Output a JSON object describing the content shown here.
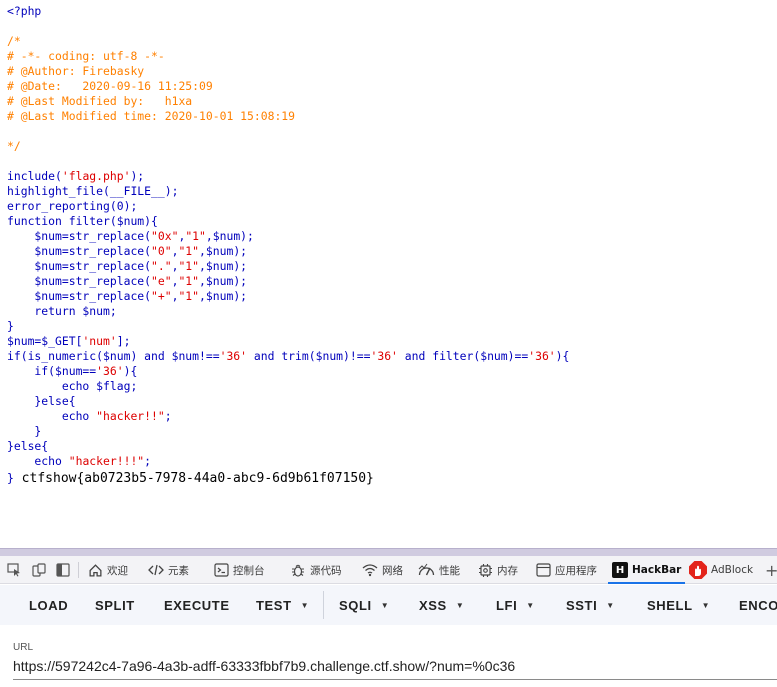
{
  "source_view": {
    "lines": [
      [
        {
          "t": "<?php",
          "c": "default"
        }
      ],
      [],
      [
        {
          "t": "/*",
          "c": "comment"
        }
      ],
      [
        {
          "t": "# -*- coding: utf-8 -*-",
          "c": "comment"
        }
      ],
      [
        {
          "t": "# @Author: Firebasky",
          "c": "comment"
        }
      ],
      [
        {
          "t": "# @Date:   2020-09-16 11:25:09",
          "c": "comment"
        }
      ],
      [
        {
          "t": "# @Last Modified by:   h1xa",
          "c": "comment"
        }
      ],
      [
        {
          "t": "# @Last Modified time: 2020-10-01 15:08:19",
          "c": "comment"
        }
      ],
      [],
      [
        {
          "t": "*/",
          "c": "comment"
        }
      ],
      [],
      [
        {
          "t": "include(",
          "c": "default"
        },
        {
          "t": "'flag.php'",
          "c": "string"
        },
        {
          "t": ");",
          "c": "default"
        }
      ],
      [
        {
          "t": "highlight_file(__FILE__);",
          "c": "default"
        }
      ],
      [
        {
          "t": "error_reporting(0);",
          "c": "default"
        }
      ],
      [
        {
          "t": "function filter($num){",
          "c": "default"
        }
      ],
      [
        {
          "t": "    $num=str_replace(",
          "c": "default"
        },
        {
          "t": "\"0x\"",
          "c": "string"
        },
        {
          "t": ",",
          "c": "default"
        },
        {
          "t": "\"1\"",
          "c": "string"
        },
        {
          "t": ",$num);",
          "c": "default"
        }
      ],
      [
        {
          "t": "    $num=str_replace(",
          "c": "default"
        },
        {
          "t": "\"0\"",
          "c": "string"
        },
        {
          "t": ",",
          "c": "default"
        },
        {
          "t": "\"1\"",
          "c": "string"
        },
        {
          "t": ",$num);",
          "c": "default"
        }
      ],
      [
        {
          "t": "    $num=str_replace(",
          "c": "default"
        },
        {
          "t": "\".\"",
          "c": "string"
        },
        {
          "t": ",",
          "c": "default"
        },
        {
          "t": "\"1\"",
          "c": "string"
        },
        {
          "t": ",$num);",
          "c": "default"
        }
      ],
      [
        {
          "t": "    $num=str_replace(",
          "c": "default"
        },
        {
          "t": "\"e\"",
          "c": "string"
        },
        {
          "t": ",",
          "c": "default"
        },
        {
          "t": "\"1\"",
          "c": "string"
        },
        {
          "t": ",$num);",
          "c": "default"
        }
      ],
      [
        {
          "t": "    $num=str_replace(",
          "c": "default"
        },
        {
          "t": "\"+\"",
          "c": "string"
        },
        {
          "t": ",",
          "c": "default"
        },
        {
          "t": "\"1\"",
          "c": "string"
        },
        {
          "t": ",$num);",
          "c": "default"
        }
      ],
      [
        {
          "t": "    return $num;",
          "c": "default"
        }
      ],
      [
        {
          "t": "}",
          "c": "default"
        }
      ],
      [
        {
          "t": "$num=$_GET[",
          "c": "default"
        },
        {
          "t": "'num'",
          "c": "string"
        },
        {
          "t": "];",
          "c": "default"
        }
      ],
      [
        {
          "t": "if(is_numeric($num) and $num!==",
          "c": "default"
        },
        {
          "t": "'36'",
          "c": "string"
        },
        {
          "t": " and trim($num)!==",
          "c": "default"
        },
        {
          "t": "'36'",
          "c": "string"
        },
        {
          "t": " and filter($num)==",
          "c": "default"
        },
        {
          "t": "'36'",
          "c": "string"
        },
        {
          "t": "){",
          "c": "default"
        }
      ],
      [
        {
          "t": "    if($num==",
          "c": "default"
        },
        {
          "t": "'36'",
          "c": "string"
        },
        {
          "t": "){",
          "c": "default"
        }
      ],
      [
        {
          "t": "        echo $flag;",
          "c": "default"
        }
      ],
      [
        {
          "t": "    }else{",
          "c": "default"
        }
      ],
      [
        {
          "t": "        echo ",
          "c": "default"
        },
        {
          "t": "\"hacker!!\"",
          "c": "string"
        },
        {
          "t": ";",
          "c": "default"
        }
      ],
      [
        {
          "t": "    }",
          "c": "default"
        }
      ],
      [
        {
          "t": "}else{",
          "c": "default"
        }
      ],
      [
        {
          "t": "    echo ",
          "c": "default"
        },
        {
          "t": "\"hacker!!!\"",
          "c": "string"
        },
        {
          "t": ";",
          "c": "default"
        }
      ]
    ],
    "closing_brace": "}",
    "flag_output": " ctfshow{ab0723b5-7978-44a0-abc9-6d9b61f07150}"
  },
  "devtools": {
    "tabs": {
      "welcome": "欢迎",
      "elements": "元素",
      "console": "控制台",
      "sources": "源代码",
      "network": "网络",
      "performance": "性能",
      "memory": "内存",
      "application": "应用程序",
      "hackbar": "HackBar",
      "adblock": "AdBlock",
      "more": "+"
    },
    "accent_color": "#1a73e8"
  },
  "hackbar": {
    "buttons": {
      "load": "LOAD",
      "split": "SPLIT",
      "execute": "EXECUTE",
      "test": "TEST",
      "sqli": "SQLI",
      "xss": "XSS",
      "lfi": "LFI",
      "ssti": "SSTI",
      "shell": "SHELL",
      "encoding": "ENCO"
    },
    "url_label": "URL",
    "url_value": "https://597242c4-7a96-4a3b-adff-63333fbbf7b9.challenge.ctf.show/?num=%0c36"
  }
}
